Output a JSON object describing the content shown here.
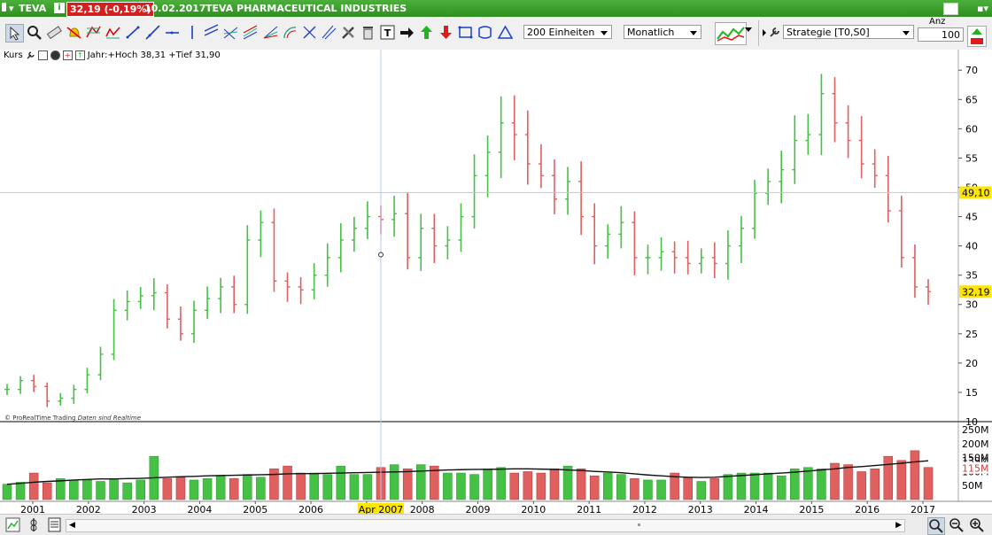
{
  "window": {
    "symbol": "TEVA",
    "price_change": "32,19 (-0,19%)",
    "date": "10.02.2017",
    "name": "TEVA PHARMACEUTICAL INDUSTRIES"
  },
  "toolbar": {
    "units": "200 Einheiten",
    "period": "Monatlich",
    "strategy": "Strategie [T0,S0]",
    "anz_label": "Anz",
    "anz_value": "100"
  },
  "legend": {
    "kurs": "Kurs",
    "info": "Jahr:+Hoch 38,31 +Tief 31,90"
  },
  "copyright": "© ProRealTime Trading",
  "copyright_note": "Daten sind Realtime",
  "crosshair": {
    "date_label": "Apr 2007",
    "price_label": "49,10",
    "last_price_label": "32,19",
    "vol_ma_label": "139M",
    "vol_last_label": "115M"
  },
  "colors": {
    "up": "#45c145",
    "down": "#e06060",
    "title_bg": "#3a9d2d",
    "highlight_yellow": "#ffe600"
  },
  "chart_data": {
    "type": "bar",
    "subtype": "ohlc-bar with volume",
    "x_labels": [
      "2001",
      "2002",
      "2003",
      "2004",
      "2005",
      "2006",
      "2007",
      "2008",
      "2009",
      "2010",
      "2011",
      "2012",
      "2013",
      "2014",
      "2015",
      "2016",
      "2017"
    ],
    "price_axis": {
      "ticks": [
        10,
        15,
        20,
        25,
        30,
        35,
        40,
        45,
        50,
        55,
        60,
        65,
        70
      ],
      "ylim": [
        10,
        72
      ]
    },
    "volume_axis": {
      "ticks": [
        "250M",
        "200M",
        "150M",
        "100M",
        "50M"
      ],
      "ylim": [
        0,
        260
      ]
    },
    "price_close": [
      15.5,
      17,
      16,
      13.5,
      14,
      15.5,
      18,
      21.5,
      29,
      30.5,
      31.5,
      32,
      27.5,
      25,
      29,
      31,
      33,
      30,
      41,
      44,
      34,
      33,
      32.5,
      35,
      38,
      41,
      43,
      45,
      44.5,
      45.5,
      38,
      43,
      40,
      41,
      45,
      52,
      56,
      61,
      59,
      54,
      52,
      48,
      51,
      45,
      40,
      42,
      44,
      38,
      38,
      39,
      38,
      37,
      38,
      37,
      40,
      43,
      49,
      51,
      53,
      58,
      59,
      66,
      61,
      58,
      54,
      52,
      46,
      38,
      33,
      32.19
    ],
    "volumes": [
      55,
      62,
      95,
      60,
      75,
      70,
      70,
      65,
      75,
      60,
      70,
      155,
      75,
      80,
      70,
      75,
      85,
      75,
      90,
      80,
      110,
      120,
      95,
      95,
      90,
      120,
      90,
      90,
      115,
      125,
      110,
      125,
      120,
      95,
      95,
      90,
      110,
      115,
      95,
      100,
      95,
      110,
      120,
      110,
      85,
      95,
      90,
      75,
      70,
      70,
      95,
      80,
      65,
      75,
      90,
      95,
      95,
      95,
      85,
      110,
      115,
      110,
      130,
      125,
      100,
      110,
      155,
      140,
      175,
      115
    ],
    "volume_ma": [
      55,
      58,
      62,
      65,
      67,
      70,
      72,
      74,
      74,
      75,
      76,
      78,
      80,
      82,
      83,
      85,
      86,
      87,
      88,
      89,
      90,
      92,
      93,
      93,
      94,
      95,
      96,
      97,
      98,
      99,
      100,
      102,
      104,
      106,
      107,
      108,
      108,
      109,
      110,
      110,
      109,
      108,
      106,
      104,
      101,
      99,
      96,
      92,
      88,
      85,
      82,
      80,
      79,
      80,
      83,
      86,
      89,
      92,
      95,
      98,
      102,
      106,
      110,
      115,
      118,
      122,
      126,
      130,
      135,
      139
    ]
  }
}
